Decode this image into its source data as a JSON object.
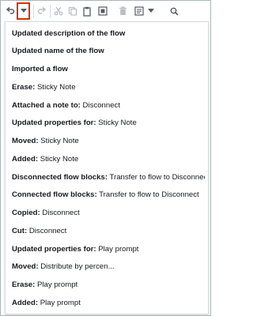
{
  "toolbar": {
    "buttons": [
      {
        "name": "undo-icon"
      },
      {
        "name": "undo-dropdown-icon"
      },
      {
        "name": "redo-icon"
      },
      {
        "name": "cut-icon"
      },
      {
        "name": "copy-icon"
      },
      {
        "name": "paste-icon"
      },
      {
        "name": "select-all-icon"
      },
      {
        "name": "delete-icon"
      },
      {
        "name": "note-icon"
      },
      {
        "name": "note-dropdown-icon"
      },
      {
        "name": "zoom-icon"
      }
    ],
    "highlight_color": "#d13212"
  },
  "history": [
    {
      "bold": "Updated description of the flow",
      "text": ""
    },
    {
      "bold": "Updated name of the flow",
      "text": ""
    },
    {
      "bold": "Imported a flow",
      "text": ""
    },
    {
      "bold": "Erase:",
      "text": " Sticky Note"
    },
    {
      "bold": "Attached a note to:",
      "text": " Disconnect"
    },
    {
      "bold": "Updated properties for:",
      "text": " Sticky Note"
    },
    {
      "bold": "Moved:",
      "text": " Sticky Note"
    },
    {
      "bold": "Added:",
      "text": " Sticky Note"
    },
    {
      "bold": "Disconnected flow blocks:",
      "text": " Transfer to flow to Disconnect"
    },
    {
      "bold": "Connected flow blocks:",
      "text": " Transfer to flow to Disconnect"
    },
    {
      "bold": "Copied:",
      "text": " Disconnect"
    },
    {
      "bold": "Cut:",
      "text": " Disconnect"
    },
    {
      "bold": "Updated properties for:",
      "text": " Play prompt"
    },
    {
      "bold": "Moved:",
      "text": " Distribute by percen..."
    },
    {
      "bold": "Erase:",
      "text": " Play prompt"
    },
    {
      "bold": "Added:",
      "text": " Play prompt"
    }
  ]
}
